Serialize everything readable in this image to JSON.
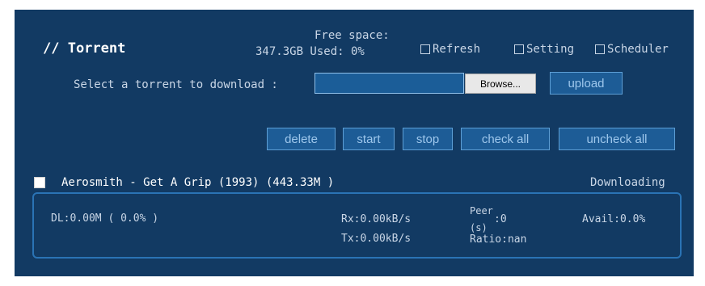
{
  "header": {
    "title": "// Torrent"
  },
  "storage": {
    "free_label": "Free space:",
    "free_value": "347.3GB  Used: 0%"
  },
  "options": {
    "refresh": "Refresh",
    "setting": "Setting",
    "scheduler": "Scheduler"
  },
  "upload_form": {
    "label": "Select a torrent to download :",
    "file_value": "",
    "browse": "Browse...",
    "upload": "upload"
  },
  "actions": {
    "delete": "delete",
    "start": "start",
    "stop": "stop",
    "check_all": "check all",
    "uncheck_all": "uncheck all"
  },
  "torrents": [
    {
      "title": "Aerosmith - Get A Grip (1993) (443.33M )",
      "status": "Downloading",
      "dl": "DL:0.00M ( 0.0% )",
      "rx": "Rx:0.00kB/s",
      "tx": "Tx:0.00kB/s",
      "peer_label_1": "Peer",
      "peer_label_2": "(s)",
      "peer_value": ":0",
      "ratio": "Ratio:nan",
      "avail": "Avail:0.0%"
    }
  ],
  "colors": {
    "panel_bg": "#123a63",
    "button_bg": "#1d5c96",
    "button_border": "#5d9fd6",
    "text": "#c9d6e6"
  }
}
